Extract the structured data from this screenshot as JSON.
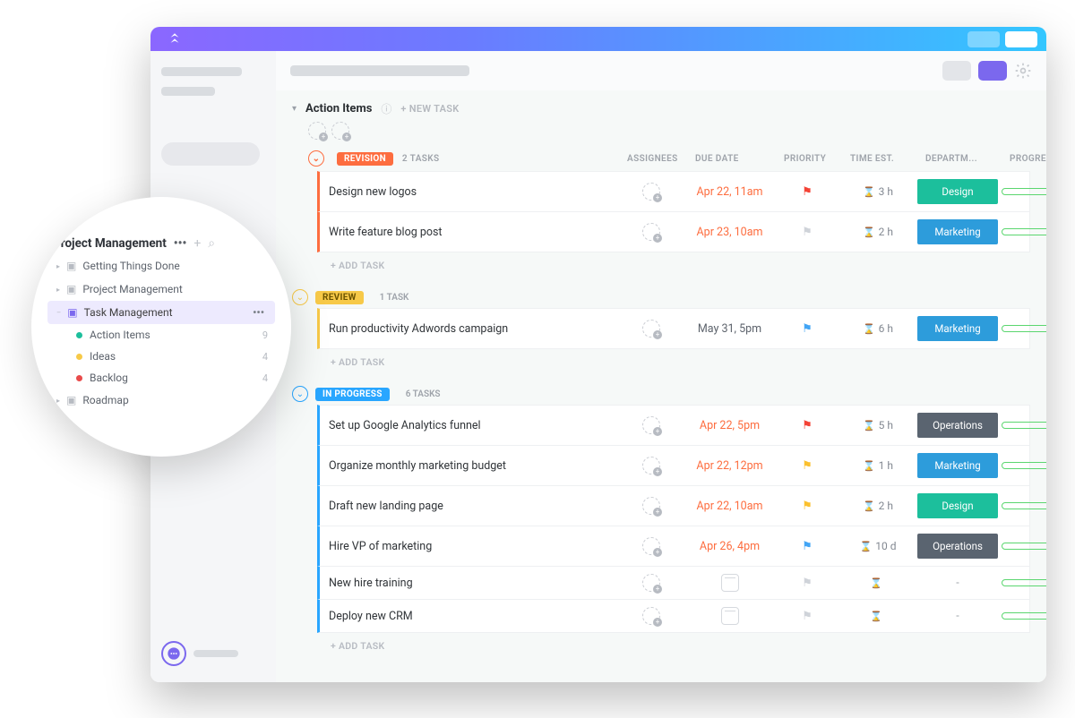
{
  "section": {
    "title": "Action Items",
    "newtask": "+ NEW TASK"
  },
  "columns": {
    "assignees": "ASSIGNEES",
    "due": "DUE DATE",
    "priority": "PRIORITY",
    "time": "TIME EST.",
    "dept": "DEPARTM...",
    "progress": "PROGRESS"
  },
  "groups": [
    {
      "key": "revision",
      "label": "REVISION",
      "count": "2 TASKS",
      "tasks": [
        {
          "name": "Design new logos",
          "date": "Apr 22, 11am",
          "dateClass": "date-red",
          "flag": "flag-red",
          "time": "3 h",
          "dept": "Design",
          "progress": "0%"
        },
        {
          "name": "Write feature blog post",
          "date": "Apr 23, 10am",
          "dateClass": "date-red",
          "flag": "flag-gray",
          "time": "2 h",
          "dept": "Marketing",
          "progress": "0%"
        }
      ]
    },
    {
      "key": "review",
      "label": "REVIEW",
      "count": "1 TASK",
      "tasks": [
        {
          "name": "Run productivity Adwords campaign",
          "date": "May 31, 5pm",
          "dateClass": "date-gray",
          "flag": "flag-blue",
          "time": "6 h",
          "dept": "Marketing",
          "progress": "0%"
        }
      ]
    },
    {
      "key": "inprogress",
      "label": "IN PROGRESS",
      "count": "6 TASKS",
      "tasks": [
        {
          "name": "Set up Google Analytics funnel",
          "date": "Apr 22, 5pm",
          "dateClass": "date-red",
          "flag": "flag-red",
          "time": "5 h",
          "dept": "Operations",
          "progress": "0%"
        },
        {
          "name": "Organize monthly marketing budget",
          "date": "Apr 22, 12pm",
          "dateClass": "date-red",
          "flag": "flag-yellow",
          "time": "1 h",
          "dept": "Marketing",
          "progress": "0%"
        },
        {
          "name": "Draft new landing page",
          "date": "Apr 22, 10am",
          "dateClass": "date-red",
          "flag": "flag-yellow",
          "time": "2 h",
          "dept": "Design",
          "progress": "0%"
        },
        {
          "name": "Hire VP of marketing",
          "date": "Apr 26, 4pm",
          "dateClass": "date-red",
          "flag": "flag-blue",
          "time": "10 d",
          "dept": "Operations",
          "progress": "0%"
        },
        {
          "name": "New hire training",
          "date": "",
          "dateClass": "",
          "flag": "flag-gray",
          "time": "",
          "dept": "-",
          "progress": "0%"
        },
        {
          "name": "Deploy new CRM",
          "date": "",
          "dateClass": "",
          "flag": "flag-gray",
          "time": "",
          "dept": "-",
          "progress": "0%"
        }
      ]
    }
  ],
  "addTask": "+ ADD TASK",
  "sideTree": {
    "title": "Project Management",
    "items": [
      {
        "label": "Getting Things Done"
      },
      {
        "label": "Project Management"
      },
      {
        "label": "Task Management",
        "selected": true,
        "children": [
          {
            "label": "Action Items",
            "dot": "g",
            "count": "9"
          },
          {
            "label": "Ideas",
            "dot": "y",
            "count": "4"
          },
          {
            "label": "Backlog",
            "dot": "r",
            "count": "4"
          }
        ]
      },
      {
        "label": "Roadmap"
      }
    ]
  }
}
